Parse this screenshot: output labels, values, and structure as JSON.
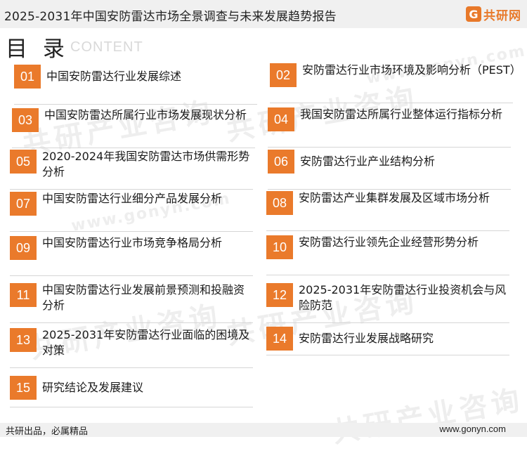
{
  "header": {
    "title": "2025-2031年中国安防雷达市场全景调查与未来发展趋势报告",
    "logo_text": "共研网",
    "logo_mark": "G"
  },
  "toc": {
    "heading": "目 录",
    "subheading": "CONTENT"
  },
  "items": [
    {
      "num": "01",
      "label": "中国安防雷达行业发展综述"
    },
    {
      "num": "02",
      "label": "安防雷达行业市场环境及影响分析（PEST）"
    },
    {
      "num": "03",
      "label": "中国安防雷达所属行业市场发展现状分析"
    },
    {
      "num": "04",
      "label": "我国安防雷达所属行业整体运行指标分析"
    },
    {
      "num": "05",
      "label": "2020-2024年我国安防雷达市场供需形势分析"
    },
    {
      "num": "06",
      "label": "安防雷达行业产业结构分析"
    },
    {
      "num": "07",
      "label": "中国安防雷达行业细分产品发展分析"
    },
    {
      "num": "08",
      "label": "安防雷达产业集群发展及区域市场分析"
    },
    {
      "num": "09",
      "label": "中国安防雷达行业市场竞争格局分析"
    },
    {
      "num": "10",
      "label": "安防雷达行业领先企业经营形势分析"
    },
    {
      "num": "11",
      "label": "中国安防雷达行业发展前景预测和投融资分析"
    },
    {
      "num": "12",
      "label": "2025-2031年安防雷达行业投资机会与风险防范"
    },
    {
      "num": "13",
      "label": "2025-2031年安防雷达行业面临的困境及对策"
    },
    {
      "num": "14",
      "label": "安防雷达行业发展战略研究"
    },
    {
      "num": "15",
      "label": "研究结论及发展建议"
    }
  ],
  "watermark": {
    "text": "共研产业咨询",
    "url": "www.gonyn.com"
  },
  "footer": {
    "left": "共研出品，必属精品",
    "right": "www.gonyn.com"
  },
  "colors": {
    "accent": "#ea7a2b",
    "header_bg": "#f0f0f0"
  }
}
